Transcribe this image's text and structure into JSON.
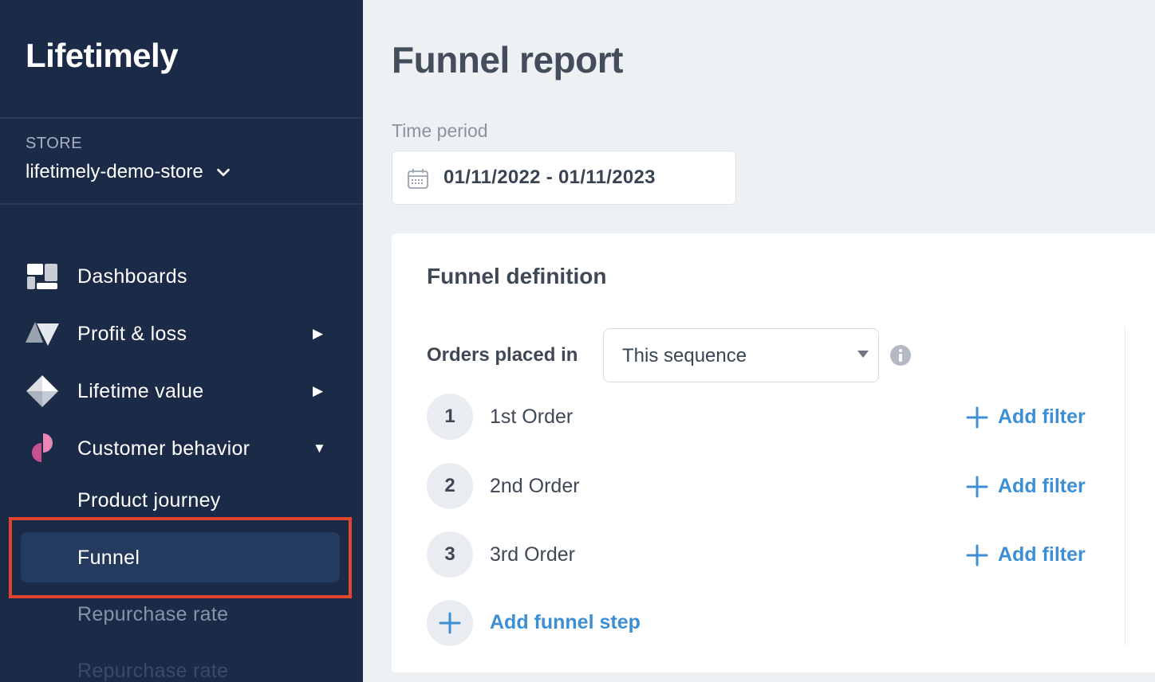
{
  "app": {
    "logo": "Lifetimely"
  },
  "store": {
    "label": "STORE",
    "name": "lifetimely-demo-store"
  },
  "nav": {
    "items": [
      {
        "label": "Dashboards",
        "arrow": ""
      },
      {
        "label": "Profit & loss",
        "arrow": "▶"
      },
      {
        "label": "Lifetime value",
        "arrow": "▶"
      },
      {
        "label": "Customer behavior",
        "arrow": "▼"
      }
    ],
    "sub_items": [
      {
        "label": "Product journey"
      },
      {
        "label": "Funnel"
      },
      {
        "label": "Repurchase rate"
      },
      {
        "label": "Repurchase rate"
      }
    ],
    "active_sub": "Funnel"
  },
  "page": {
    "title": "Funnel report",
    "time_period_label": "Time period",
    "date_range": "01/11/2022 - 01/11/2023"
  },
  "funnel": {
    "title": "Funnel definition",
    "orders_label": "Orders placed in",
    "sequence_value": "This sequence",
    "steps": [
      {
        "number": "1",
        "label": "1st Order",
        "action": "Add filter"
      },
      {
        "number": "2",
        "label": "2nd Order",
        "action": "Add filter"
      },
      {
        "number": "3",
        "label": "3rd Order",
        "action": "Add filter"
      }
    ],
    "add_step_label": "Add funnel step"
  },
  "colors": {
    "sidebar": "#1b2a47",
    "accent": "#3d8fd5",
    "highlight": "#e2452b"
  }
}
